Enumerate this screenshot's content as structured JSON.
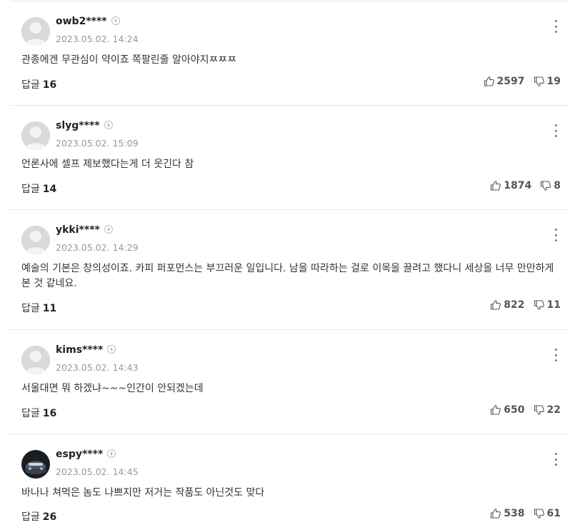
{
  "comments": [
    {
      "nickname": "owb2****",
      "date": "2023.05.02. 14:24",
      "text": "관종에겐 무관심이 약이죠 쪽팔린줄 알아야지ㅉㅉㅉ",
      "reply_label": "답글",
      "reply_count": "16",
      "likes": "2597",
      "dislikes": "19",
      "avatar": "default"
    },
    {
      "nickname": "slyg****",
      "date": "2023.05.02. 15:09",
      "text": "언론사에 셀프 제보했다는게 더 웃긴다 참",
      "reply_label": "답글",
      "reply_count": "14",
      "likes": "1874",
      "dislikes": "8",
      "avatar": "default"
    },
    {
      "nickname": "ykki****",
      "date": "2023.05.02. 14:29",
      "text": "예술의 기본은 창의성이죠. 카피 퍼포먼스는 부끄러운 일입니다. 남을 따라하는 걸로 이목을 끌려고 했다니 세상을 너무 만만하게 본 것 같네요.",
      "reply_label": "답글",
      "reply_count": "11",
      "likes": "822",
      "dislikes": "11",
      "avatar": "default"
    },
    {
      "nickname": "kims****",
      "date": "2023.05.02. 14:43",
      "text": "서울대면 뭐 하겠냐~~~인간이 안되겠는데",
      "reply_label": "답글",
      "reply_count": "16",
      "likes": "650",
      "dislikes": "22",
      "avatar": "default"
    },
    {
      "nickname": "espy****",
      "date": "2023.05.02. 14:45",
      "text": "바나나 쳐먹은 놈도 나쁘지만 저거는 작품도 아닌것도 맞다",
      "reply_label": "답글",
      "reply_count": "26",
      "likes": "538",
      "dislikes": "61",
      "avatar": "photo"
    }
  ],
  "icons": {
    "like": "thumbs-up-icon",
    "dislike": "thumbs-down-icon",
    "more": "more-vertical-icon",
    "profile": "chevron-right-icon"
  }
}
